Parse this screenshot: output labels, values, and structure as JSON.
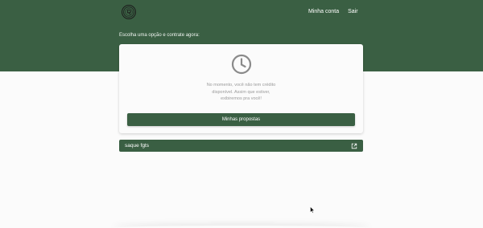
{
  "header": {
    "logo_icon": "brand-seal-icon",
    "nav": {
      "account_label": "Minha conta",
      "logout_label": "Sair"
    }
  },
  "main": {
    "intro_text": "Escolha uma opção e contrate agora:",
    "card": {
      "icon": "clock-icon",
      "message": "No momento, você não tem crédito disponível. Assim que estiver, exibiremos pra você!",
      "button_label": "Minhas propostas"
    },
    "link_item": {
      "label": "saque fgts",
      "icon": "external-link-icon"
    }
  },
  "colors": {
    "brand_green": "#3a5f43",
    "background": "#fbfbfb",
    "muted_text": "#9a9a9a"
  }
}
